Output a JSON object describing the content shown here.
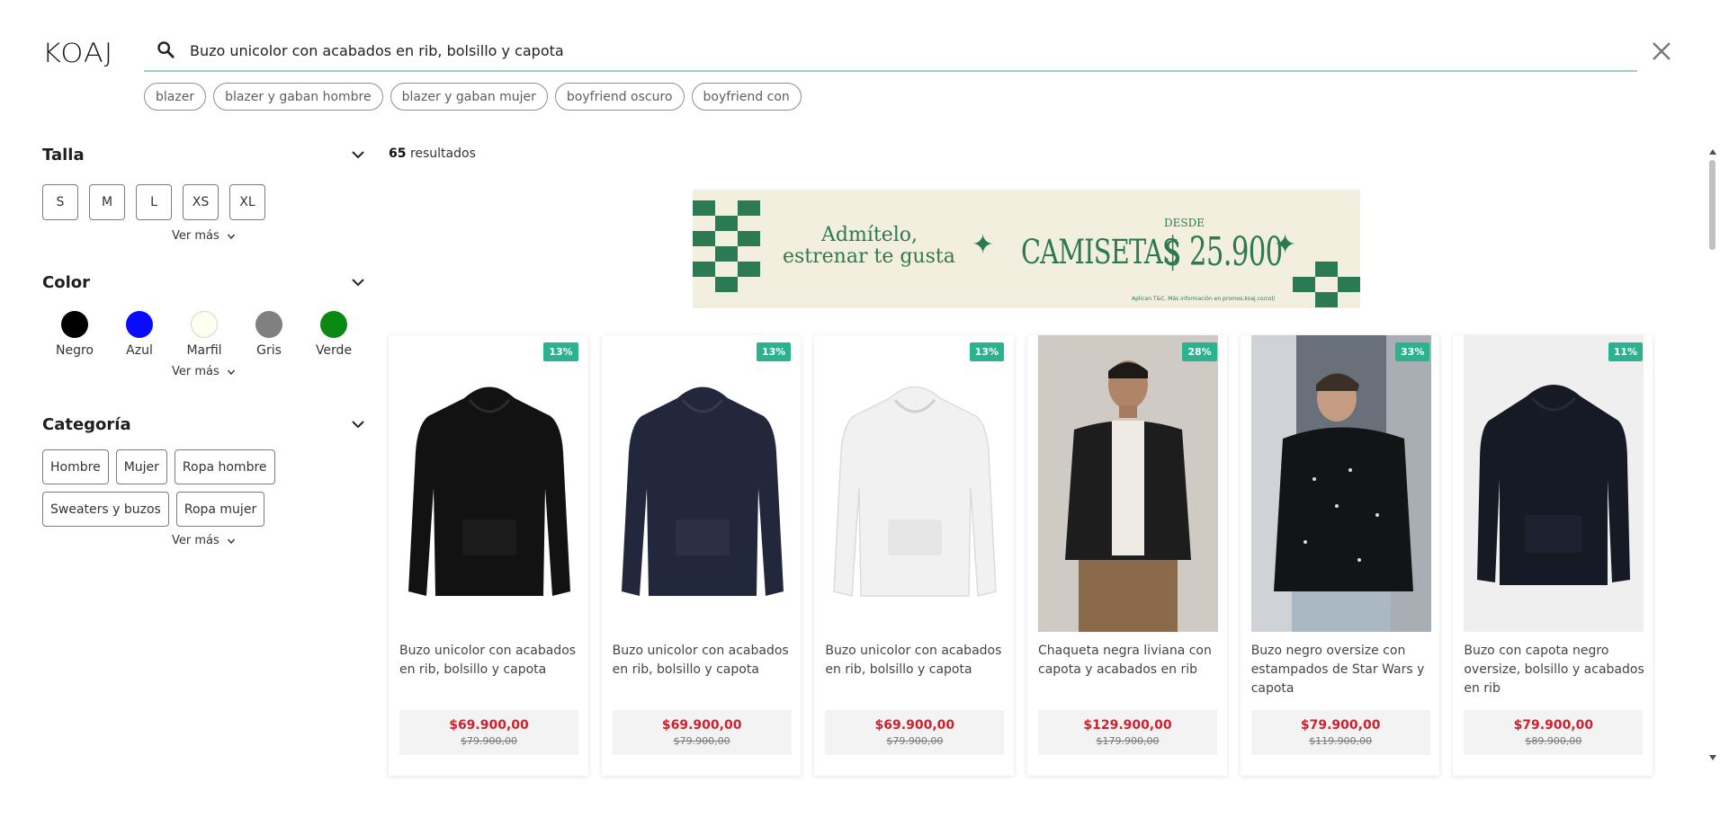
{
  "brand": {
    "logo_text": "KOAJ"
  },
  "search": {
    "value": "Buzo unicolor con acabados en rib, bolsillo y capota",
    "icon": "search-icon",
    "close_icon": "close-icon"
  },
  "suggestions": [
    "blazer",
    "blazer y gaban hombre",
    "blazer y gaban mujer",
    "boyfriend oscuro",
    "boyfriend con"
  ],
  "filters": {
    "talla": {
      "title": "Talla",
      "options": [
        "S",
        "M",
        "L",
        "XS",
        "XL"
      ],
      "more": "Ver más"
    },
    "color": {
      "title": "Color",
      "options": [
        {
          "label": "Negro",
          "hex": "#000000"
        },
        {
          "label": "Azul",
          "hex": "#0a0aff"
        },
        {
          "label": "Marfil",
          "hex": "#fffff0"
        },
        {
          "label": "Gris",
          "hex": "#808080"
        },
        {
          "label": "Verde",
          "hex": "#0a8a14"
        }
      ],
      "more": "Ver más"
    },
    "categoria": {
      "title": "Categoría",
      "options": [
        "Hombre",
        "Mujer",
        "Ropa hombre",
        "Sweaters y buzos",
        "Ropa mujer"
      ],
      "more": "Ver más"
    }
  },
  "results": {
    "count": "65",
    "label": "resultados"
  },
  "banner": {
    "line1": "Admítelo,",
    "line2": "estrenar te gusta",
    "headline": "CAMISETAS",
    "desde": "DESDE",
    "price": "$ 25.900",
    "fine_print": "Aplican T&C. Más información en promos.koaj.co/col/",
    "accent_color": "#2c7a53",
    "background_color": "#f3efdf"
  },
  "products": [
    {
      "discount": "13%",
      "name": "Buzo unicolor con acabados en rib, bolsillo y capota",
      "price": "$69.900,00",
      "old_price": "$79.900,00",
      "image": "black-hoodie"
    },
    {
      "discount": "13%",
      "name": "Buzo unicolor con acabados en rib, bolsillo y capota",
      "price": "$69.900,00",
      "old_price": "$79.900,00",
      "image": "navy-hoodie"
    },
    {
      "discount": "13%",
      "name": "Buzo unicolor con acabados en rib, bolsillo y capota",
      "price": "$69.900,00",
      "old_price": "$79.900,00",
      "image": "white-hoodie"
    },
    {
      "discount": "28%",
      "name": "Chaqueta negra liviana con capota y acabados en rib",
      "price": "$129.900,00",
      "old_price": "$179.900,00",
      "image": "model-black-jacket"
    },
    {
      "discount": "33%",
      "name": "Buzo negro oversize con estampados de Star Wars y capota",
      "price": "$79.900,00",
      "old_price": "$119.900,00",
      "image": "model-star-wars-hoodie"
    },
    {
      "discount": "11%",
      "name": "Buzo con capota negro oversize, bolsillo y acabados en rib",
      "price": "$79.900,00",
      "old_price": "$89.900,00",
      "image": "oversize-black-hoodie"
    }
  ],
  "colors": {
    "discount_badge": "#2bb38f",
    "sale_price": "#d41f2c",
    "search_underline": "#9fcfbf"
  }
}
